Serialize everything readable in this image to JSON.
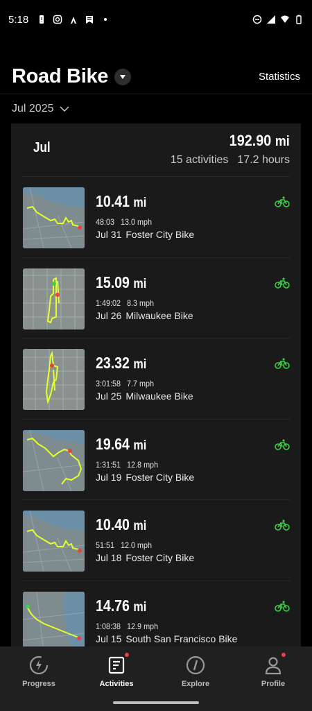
{
  "status_bar": {
    "time": "5:18"
  },
  "header": {
    "title": "Road Bike",
    "statistics_label": "Statistics"
  },
  "month_selector": {
    "value": "Jul 2025"
  },
  "summary": {
    "month": "Jul",
    "distance": "192.90",
    "distance_unit": "mi",
    "activities": "15 activities",
    "hours": "17.2 hours"
  },
  "activities": [
    {
      "distance": "10.41",
      "unit": "mi",
      "duration": "48:03",
      "speed": "13.0 mph",
      "date": "Jul 31",
      "name": "Foster City Bike"
    },
    {
      "distance": "15.09",
      "unit": "mi",
      "duration": "1:49:02",
      "speed": "8.3 mph",
      "date": "Jul 26",
      "name": "Milwaukee Bike"
    },
    {
      "distance": "23.32",
      "unit": "mi",
      "duration": "3:01:58",
      "speed": "7.7 mph",
      "date": "Jul 25",
      "name": "Milwaukee Bike"
    },
    {
      "distance": "19.64",
      "unit": "mi",
      "duration": "1:31:51",
      "speed": "12.8 mph",
      "date": "Jul 19",
      "name": "Foster City Bike"
    },
    {
      "distance": "10.40",
      "unit": "mi",
      "duration": "51:51",
      "speed": "12.0 mph",
      "date": "Jul 18",
      "name": "Foster City Bike"
    },
    {
      "distance": "14.76",
      "unit": "mi",
      "duration": "1:08:38",
      "speed": "12.9 mph",
      "date": "Jul 15",
      "name": "South San Francisco Bike"
    }
  ],
  "bottom_nav": [
    {
      "label": "Progress"
    },
    {
      "label": "Activities"
    },
    {
      "label": "Explore"
    },
    {
      "label": "Profile"
    }
  ],
  "colors": {
    "accent_green": "#3ecf4a",
    "route_yellow": "#e6ff2a",
    "badge_red": "#e8404a"
  }
}
